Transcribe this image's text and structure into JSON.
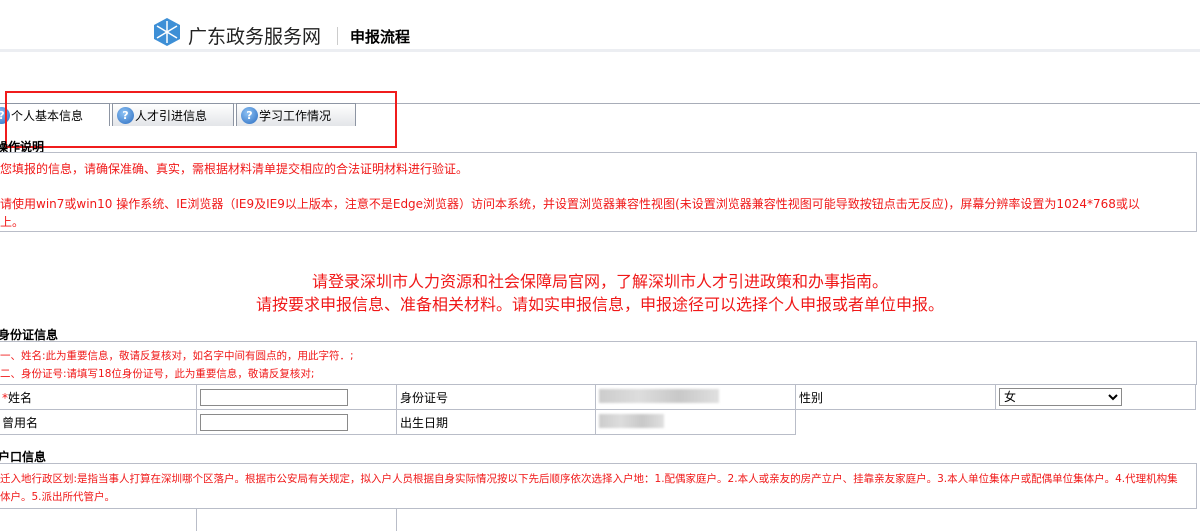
{
  "header": {
    "site_name": "广东政务服务网",
    "section": "申报流程"
  },
  "tabs": [
    {
      "label": "个人基本信息"
    },
    {
      "label": "人才引进信息"
    },
    {
      "label": "学习工作情况"
    }
  ],
  "instructions": {
    "title": "操作说明",
    "lines": [
      "您填报的信息，请确保准确、真实，需根据材料清单提交相应的合法证明材料进行验证。",
      "请使用win7或win10 操作系统、IE浏览器（IE9及IE9以上版本，注意不是Edge浏览器）访问本系统，并设置浏览器兼容性视图(未设置浏览器兼容性视图可能导致按钮点击无反应)，屏幕分辨率设置为1024*768或以",
      "上。"
    ]
  },
  "notice": [
    "请登录深圳市人力资源和社会保障局官网，了解深圳市人才引进政策和办事指南。",
    "请按要求申报信息、准备相关材料。请如实申报信息，申报途径可以选择个人申报或者单位申报。"
  ],
  "id_section": {
    "title": "身份证信息",
    "notes": [
      "一、姓名:此为重要信息，敬请反复核对，如名字中间有圆点的，用此字符．;",
      "二、身份证号:请填写18位身份证号，此为重要信息，敬请反复核对;"
    ],
    "fields": {
      "name_req": "*",
      "name_label": "姓名",
      "id_label": "身份证号",
      "gender_label": "性别",
      "gender_value": "女",
      "former_name_label": "曾用名",
      "birth_label": "出生日期"
    }
  },
  "hukou_section": {
    "title": "户口信息",
    "notes": [
      "迁入地行政区划:是指当事人打算在深圳哪个区落户。根据市公安局有关规定，拟入户人员根据自身实际情况按以下先后顺序依次选择入户地：1.配偶家庭户。2.本人或亲友的房产立户、挂靠亲友家庭户。3.本人单位集体户或配偶单位集体户。4.代理机构集",
      "体户。5.派出所代管户。"
    ]
  }
}
